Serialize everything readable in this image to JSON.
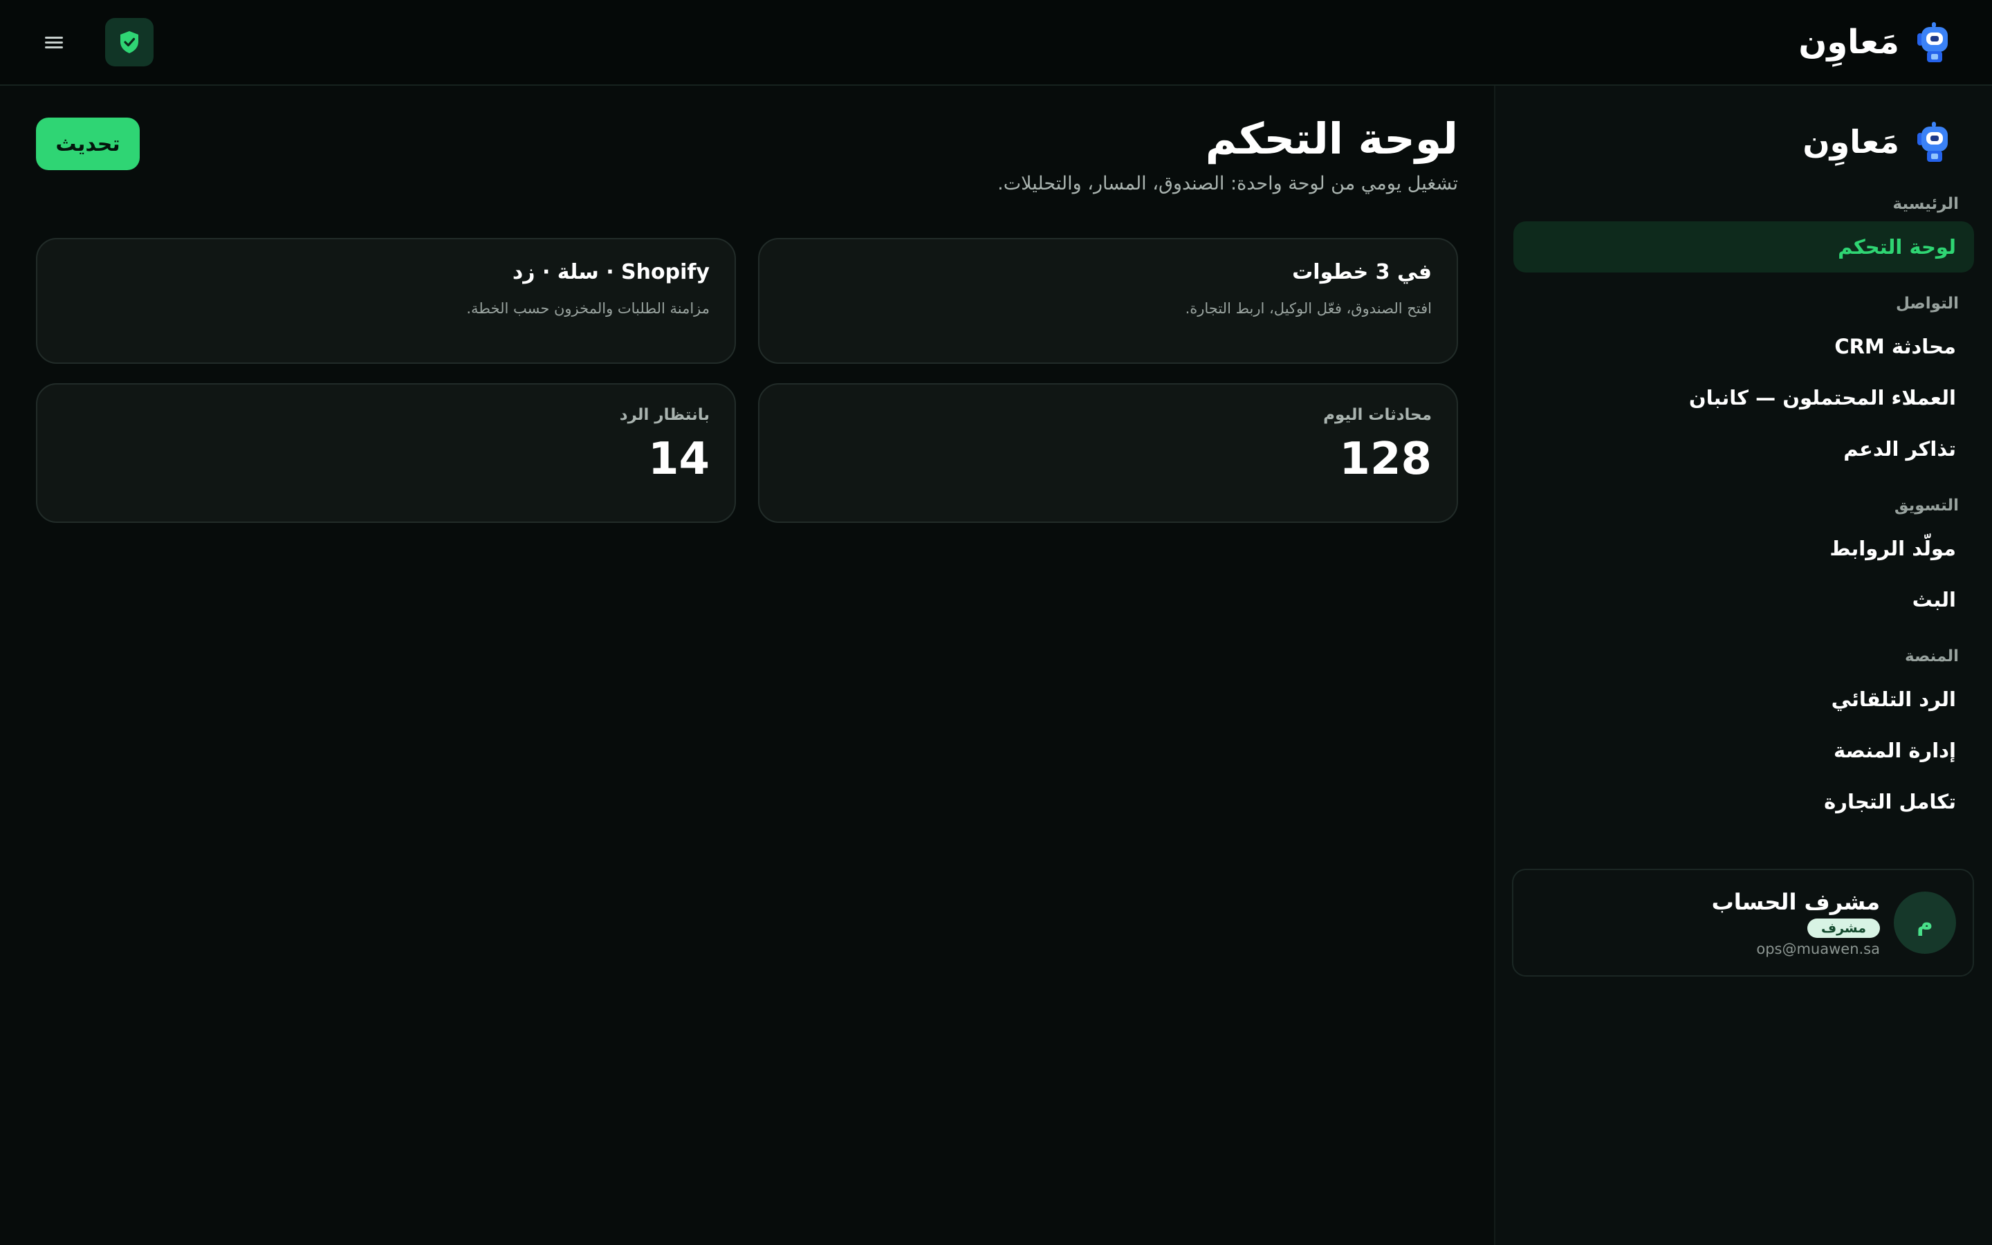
{
  "brand": {
    "name": "مَعاوِن"
  },
  "sidebar": {
    "sections": [
      {
        "title": "الرئيسية",
        "items": [
          {
            "label": "لوحة التحكم",
            "active": true
          }
        ]
      },
      {
        "title": "التواصل",
        "items": [
          {
            "label": "محادثة CRM"
          },
          {
            "label": "العملاء المحتملون — كانبان"
          },
          {
            "label": "تذاكر الدعم"
          }
        ]
      },
      {
        "title": "التسويق",
        "items": [
          {
            "label": "مولّد الروابط"
          },
          {
            "label": "البث"
          }
        ]
      },
      {
        "title": "المنصة",
        "items": [
          {
            "label": "الرد التلقائي"
          },
          {
            "label": "إدارة المنصة"
          },
          {
            "label": "تكامل التجارة"
          }
        ]
      }
    ]
  },
  "user": {
    "avatar_letter": "م",
    "name": "مشرف الحساب",
    "role": "مشرف",
    "email": "ops@muawen.sa"
  },
  "main": {
    "title": "لوحة التحكم",
    "subtitle": "تشغيل يومي من لوحة واحدة: الصندوق، المسار، والتحليلات.",
    "refresh_label": "تحديث",
    "cards": [
      {
        "title": "في 3 خطوات",
        "desc": "افتح الصندوق، فعّل الوكيل، اربط التجارة."
      },
      {
        "title": "Shopify · سلة · زد",
        "desc": "مزامنة الطلبات والمخزون حسب الخطة."
      }
    ],
    "stats": [
      {
        "label": "محادثات اليوم",
        "value": "128"
      },
      {
        "label": "بانتظار الرد",
        "value": "14"
      }
    ]
  },
  "colors": {
    "accent": "#2fd574",
    "background": "#070c0b",
    "active_nav_bg": "#0e2a1c"
  },
  "icons": {
    "menu": "hamburger-menu-icon",
    "security": "shield-check-icon",
    "logo": "robot-logo-icon"
  }
}
